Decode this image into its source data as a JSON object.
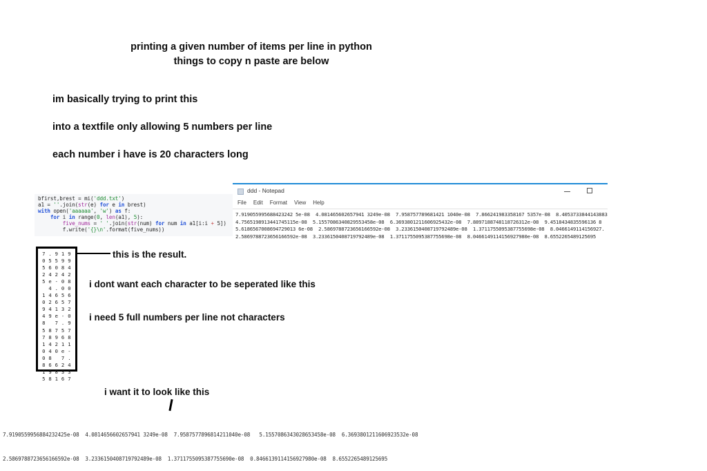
{
  "headline": {
    "line1": "printing a given number of items per line in python",
    "line2": "things to copy n paste are below"
  },
  "statements": [
    "im basically trying to print this",
    "into a textfile only allowing 5 numbers per line",
    "each number i have is 20 characters long"
  ],
  "code_block": {
    "language": "python",
    "line1_a": "bfirst,brest = mi(",
    "line1_b": "'ddd.txt'",
    "line1_c": ")",
    "line2_a": "a1 = ",
    "line2_b": "''",
    "line2_c": ".join(",
    "line2_d": "str",
    "line2_e": "(e) ",
    "line2_f": "for",
    "line2_g": " e ",
    "line2_h": "in",
    "line2_i": " brest)",
    "line3_a": "with",
    "line3_b": " open(",
    "line3_c": "'aaaaaa'",
    "line3_d": ", ",
    "line3_e": "'w'",
    "line3_f": ") ",
    "line3_g": "as",
    "line3_h": " f:",
    "line4_a": "    ",
    "line4_b": "for",
    "line4_c": " i ",
    "line4_d": "in",
    "line4_e": " range(",
    "line4_f": "0",
    "line4_g": ", ",
    "line4_h": "len",
    "line4_i": "(a1), ",
    "line4_j": "5",
    "line4_k": "):",
    "line5_a": "        ",
    "line5_b": "five_nums",
    "line5_c": " = ",
    "line5_d": "' '",
    "line5_e": ".join(",
    "line5_f": "str",
    "line5_g": "(num) ",
    "line5_h": "for",
    "line5_i": " num ",
    "line5_j": "in",
    "line5_k": " a1[i:i ",
    "line5_l": "+",
    "line5_m": " 5])",
    "line6_a": "        f.write(",
    "line6_b": "'{}\\n'",
    "line6_c": ".format(five_nums))"
  },
  "notepad": {
    "title": "ddd - Notepad",
    "menu": [
      "File",
      "Edit",
      "Format",
      "View",
      "Help"
    ],
    "minimize_label": "minimize",
    "maximize_label": "maximize",
    "accent_color": "#1d8ad6",
    "content_lines": [
      "7.919055995688423242 5e-08  4.081465602657941 3249e-08  7.958757789681421 1040e-08  7.866241983358167 5357e-08  8.4053733844143883",
      "4.7565198913441745115e-08  5.1557086340829553458e-08  6.3693801211606925432e-08  7.8897188748118726312e-08  9.4518434835596136 8",
      "5.6186567008694729013 6e-08  2.5869788723656166592e-08  3.2336150408719792489e-08  1.3711755095387755698e-08  8.0466149114156927.",
      "2.5869788723656166592e-08  3.2336150408719792489e-08  1.3711755095387755698e-08  8.0466149114156927980e-08  8.6552265489125695"
    ]
  },
  "result_box": {
    "description": "one character per column, five characters per line",
    "lines": [
      "7 . 9 1 9",
      "0 5 5 9 9",
      "5 6 0 8 4",
      "2 4 2 4 2",
      "5 e - 0 8",
      "  4 . 0 0",
      "1 4 6 5 6",
      "0 2 6 5 7",
      "9 4 1 3 2",
      "4 9 e - 0",
      "8   7 . 9",
      "5 8 7 5 7",
      "7 8 9 6 8",
      "1 4 2 1 1",
      "0 4 0 e -",
      "0 8   7 .",
      "8 6 6 2 4",
      "1 9 8 3 3",
      "5 8 1 6 7"
    ]
  },
  "annotations": {
    "result": "this is the result.",
    "complaint1": "i dont want each character to be seperated like this",
    "complaint2": "i need 5 full numbers per line not characters",
    "desire": "i want it to look like this"
  },
  "desired_output": {
    "line1": "7.9190559956884232425e-08  4.0814656602657941 3249e-08  7.9587577896814211040e-08   5.1557086343028653458e-08  6.3693801211606923532e-08",
    "line2": "2.5869788723656166592e-08  3.2336150408719792489e-08  1.3711755095387755690e-08  0.8466139114156927980e-08  8.6552265489125695"
  }
}
